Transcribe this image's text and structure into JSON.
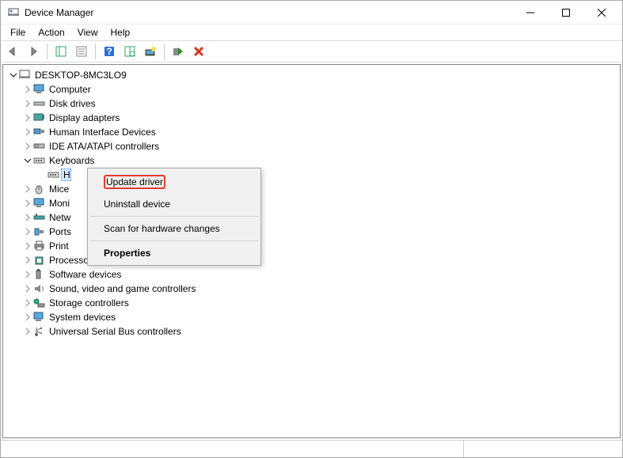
{
  "window": {
    "title": "Device Manager"
  },
  "menu": {
    "file": "File",
    "action": "Action",
    "view": "View",
    "help": "Help"
  },
  "tree": {
    "root": "DESKTOP-8MC3LO9",
    "nodes": {
      "computer": "Computer",
      "disk_drives": "Disk drives",
      "display_adapters": "Display adapters",
      "hid": "Human Interface Devices",
      "ide": "IDE ATA/ATAPI controllers",
      "keyboards": "Keyboards",
      "keyboard_child": "H",
      "mice": "Mice",
      "monitors": "Moni",
      "network": "Netw",
      "ports": "Ports",
      "print": "Print",
      "processors": "Processors",
      "software_devices": "Software devices",
      "sound": "Sound, video and game controllers",
      "storage": "Storage controllers",
      "system": "System devices",
      "usb": "Universal Serial Bus controllers"
    }
  },
  "context_menu": {
    "update": "Update driver",
    "uninstall": "Uninstall device",
    "scan": "Scan for hardware changes",
    "properties": "Properties"
  }
}
